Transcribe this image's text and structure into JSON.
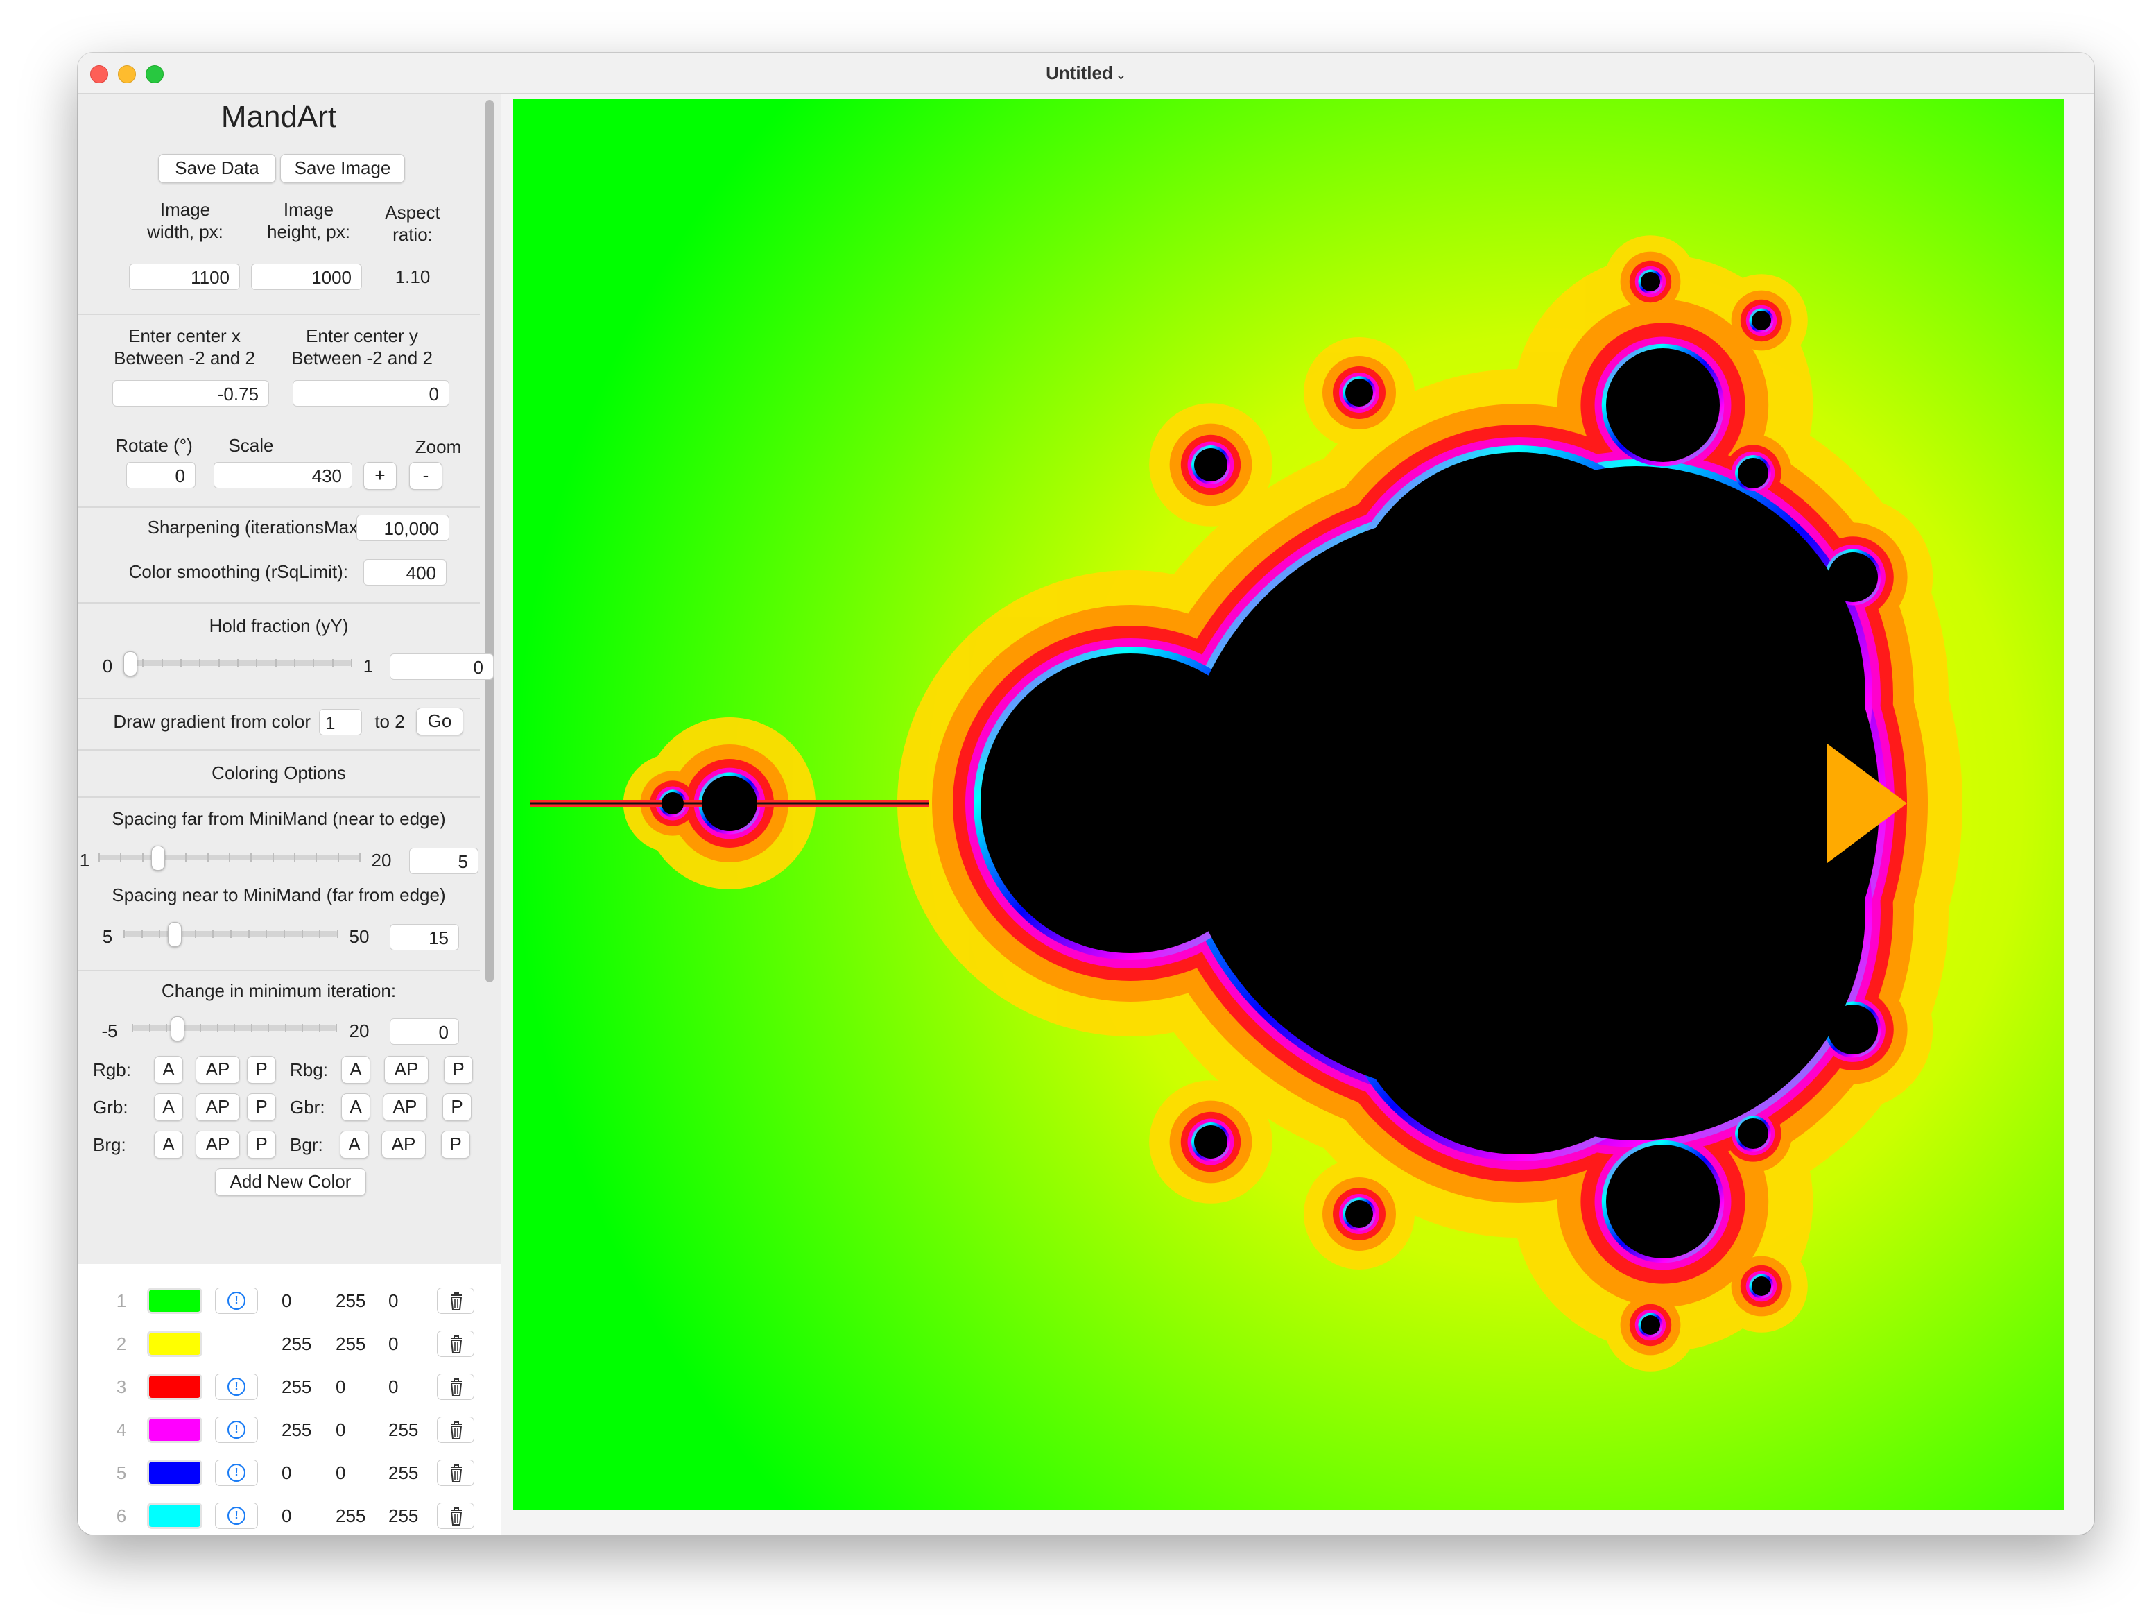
{
  "window": {
    "title": "Untitled"
  },
  "app": {
    "title": "MandArt"
  },
  "toolbar": {
    "save_data": "Save Data",
    "save_image": "Save Image"
  },
  "image": {
    "width_label": "Image\nwidth, px:",
    "height_label": "Image\nheight, px:",
    "aspect_label": "Aspect\nratio:",
    "width_value": "1100",
    "height_value": "1000",
    "aspect_value": "1.10"
  },
  "center": {
    "x_label": "Enter center x\nBetween -2 and 2",
    "y_label": "Enter center y\nBetween -2 and 2",
    "x_value": "-0.75",
    "y_value": "0"
  },
  "transform": {
    "rotate_label": "Rotate (°)",
    "scale_label": "Scale",
    "zoom_label": "Zoom",
    "rotate_value": "0",
    "scale_value": "430",
    "zoom_in": "+",
    "zoom_out": "-"
  },
  "sharpening": {
    "label": "Sharpening (iterationsMax):",
    "value": "10,000"
  },
  "smoothing": {
    "label": "Color smoothing (rSqLimit):",
    "value": "400"
  },
  "hold": {
    "label": "Hold fraction (yY)",
    "min": "0",
    "max": "1",
    "value": "0",
    "level": 0.0
  },
  "gradient": {
    "label": "Draw gradient from color",
    "from": "1",
    "to_label": "to 2",
    "go": "Go"
  },
  "coloring": {
    "label": "Coloring Options"
  },
  "spacing_far": {
    "label": "Spacing far from MiniMand (near to edge)",
    "min": "1",
    "max": "20",
    "value": "5",
    "level": 0.21
  },
  "spacing_near": {
    "label": "Spacing near to MiniMand (far from edge)",
    "min": "5",
    "max": "50",
    "value": "15",
    "level": 0.22
  },
  "min_iter": {
    "label": "Change in minimum iteration:",
    "min": "-5",
    "max": "20",
    "value": "0",
    "level": 0.2
  },
  "palettes": [
    {
      "name": "Rgb:",
      "a": "A",
      "ap": "AP",
      "p": "P"
    },
    {
      "name": "Rbg:",
      "a": "A",
      "ap": "AP",
      "p": "P"
    },
    {
      "name": "Grb:",
      "a": "A",
      "ap": "AP",
      "p": "P"
    },
    {
      "name": "Gbr:",
      "a": "A",
      "ap": "AP",
      "p": "P"
    },
    {
      "name": "Brg:",
      "a": "A",
      "ap": "AP",
      "p": "P"
    },
    {
      "name": "Bgr:",
      "a": "A",
      "ap": "AP",
      "p": "P"
    }
  ],
  "add_color": "Add New Color",
  "colors": [
    {
      "index": "1",
      "hex": "#00ff00",
      "r": "0",
      "g": "255",
      "b": "0",
      "info": true
    },
    {
      "index": "2",
      "hex": "#ffff00",
      "r": "255",
      "g": "255",
      "b": "0",
      "info": false
    },
    {
      "index": "3",
      "hex": "#ff0000",
      "r": "255",
      "g": "0",
      "b": "0",
      "info": true
    },
    {
      "index": "4",
      "hex": "#ff00ff",
      "r": "255",
      "g": "0",
      "b": "255",
      "info": true
    },
    {
      "index": "5",
      "hex": "#0000ff",
      "r": "0",
      "g": "0",
      "b": "255",
      "info": true
    },
    {
      "index": "6",
      "hex": "#00ffff",
      "r": "0",
      "g": "255",
      "b": "255",
      "info": true
    }
  ],
  "icons": {
    "info": "info-icon",
    "trash": "trash-icon"
  }
}
